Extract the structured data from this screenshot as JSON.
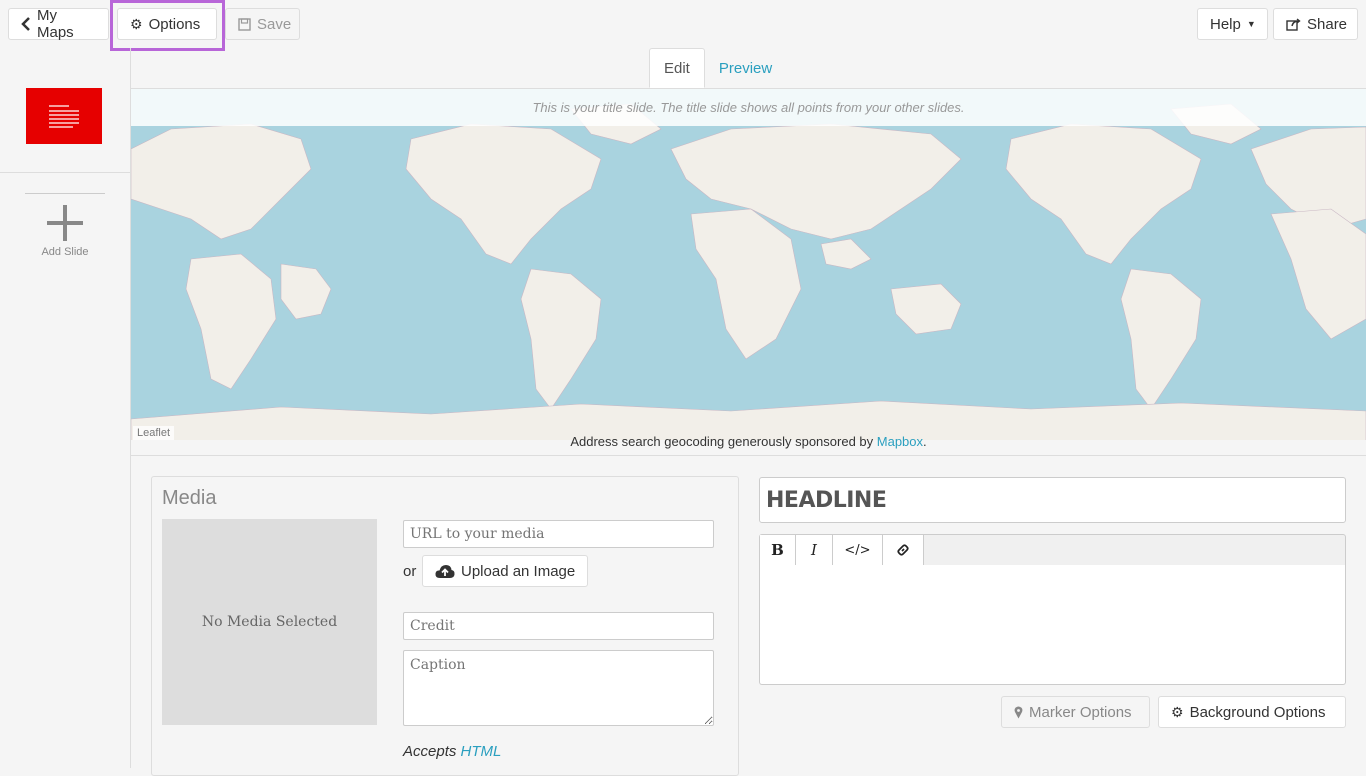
{
  "toolbar": {
    "my_maps": "My Maps",
    "options": "Options",
    "save": "Save",
    "help": "Help",
    "share": "Share"
  },
  "tabs": {
    "edit": "Edit",
    "preview": "Preview"
  },
  "sidebar": {
    "add_slide": "Add Slide"
  },
  "map": {
    "title_note": "This is your title slide. The title slide shows all points from your other slides.",
    "attribution": "Leaflet",
    "geocoding_prefix": "Address search geocoding generously sponsored by ",
    "geocoding_link": "Mapbox",
    "geocoding_suffix": "."
  },
  "media": {
    "title": "Media",
    "empty": "No Media Selected",
    "url_placeholder": "URL to your media",
    "or": "or",
    "upload": "Upload an Image",
    "credit_placeholder": "Credit",
    "caption_placeholder": "Caption",
    "accepts_prefix": "Accepts ",
    "accepts_link": "HTML"
  },
  "text": {
    "headline": "HEADLINE",
    "bold": "B",
    "italic": "I",
    "code": "</>",
    "marker_options": "Marker Options",
    "background_options": "Background Options"
  },
  "colors": {
    "accent": "#2a9fbf",
    "slide": "#e60000",
    "highlight": "#b866d8"
  }
}
